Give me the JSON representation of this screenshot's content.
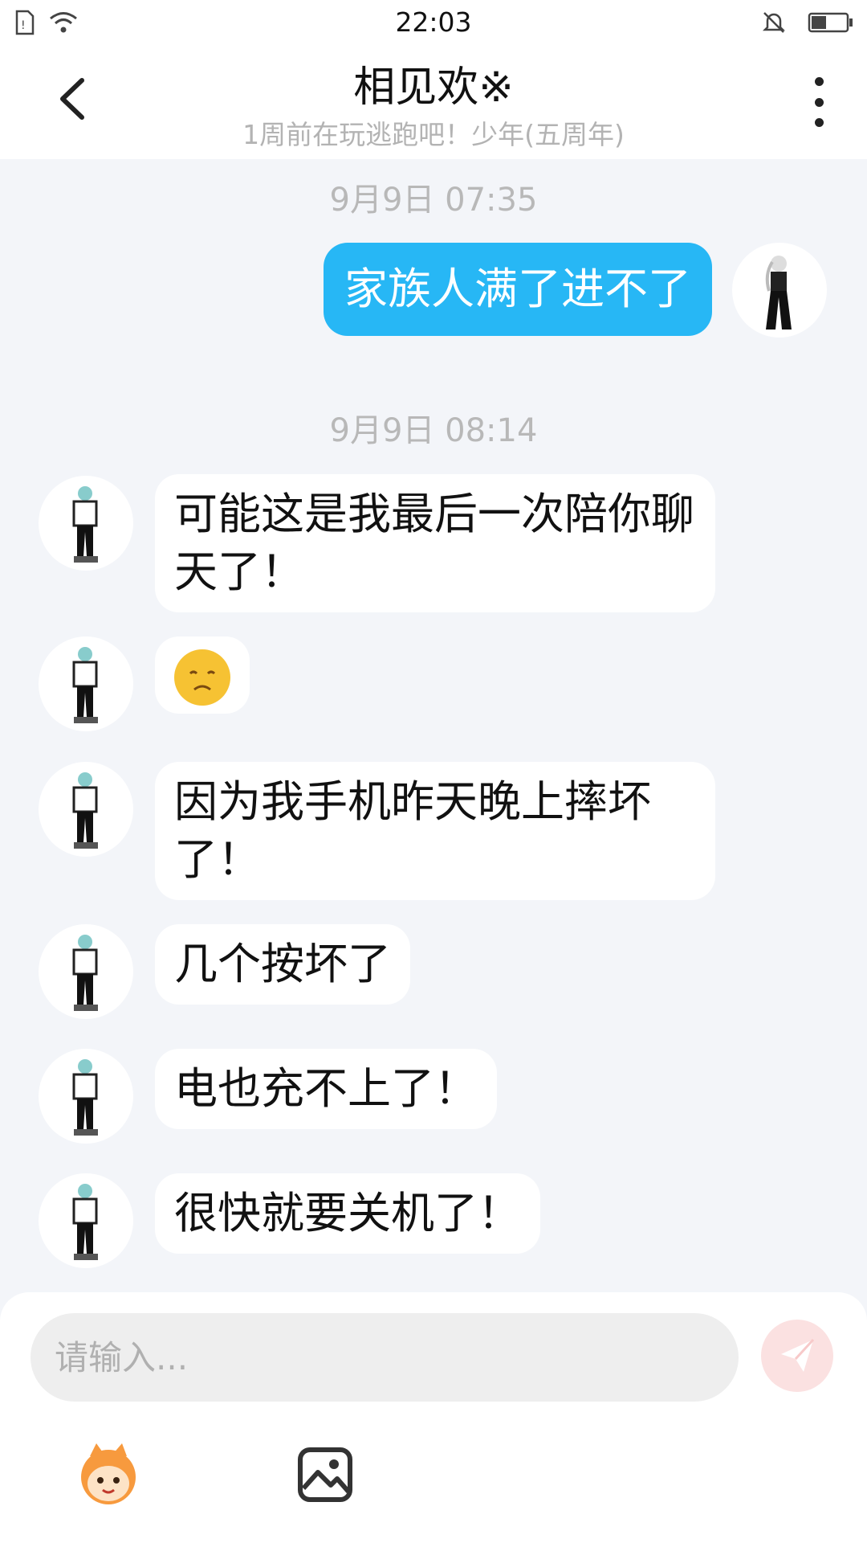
{
  "status_bar": {
    "time": "22:03"
  },
  "header": {
    "title": "相见欢※",
    "subtitle": "1周前在玩逃跑吧！少年(五周年)"
  },
  "messages": [
    {
      "time": "9月9日 07:35"
    },
    {
      "from": "me",
      "text": "家族人满了进不了"
    },
    {
      "time": "9月9日 08:14"
    },
    {
      "from": "peer",
      "text": "可能这是我最后一次陪你聊天了！"
    },
    {
      "from": "peer",
      "emoji": "disappointed-face"
    },
    {
      "from": "peer",
      "text": "因为我手机昨天晚上摔坏了！"
    },
    {
      "from": "peer",
      "text": "几个按坏了"
    },
    {
      "from": "peer",
      "text": "电也充不上了！"
    },
    {
      "from": "peer",
      "text": "很快就要关机了！"
    }
  ],
  "input": {
    "placeholder": "请输入..."
  },
  "colors": {
    "outgoing_bubble": "#27b7f5",
    "incoming_bubble": "#ffffff",
    "send_button": "#fbe1e1",
    "background": "#f3f5f9"
  },
  "icons": [
    "sim-icon",
    "wifi-icon",
    "mute-bell-icon",
    "battery-icon",
    "back-arrow-icon",
    "more-vertical-icon",
    "send-icon",
    "emoji-mascot-icon",
    "image-icon"
  ]
}
